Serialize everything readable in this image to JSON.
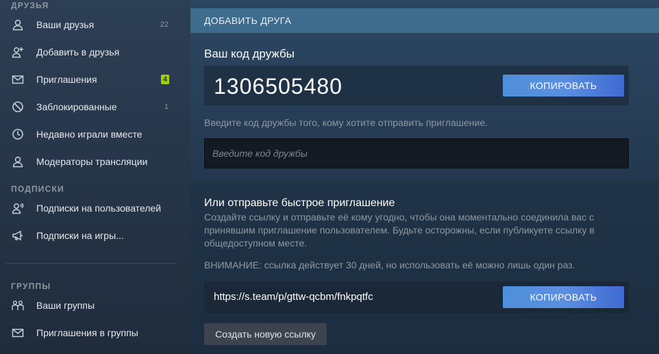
{
  "sidebar": {
    "friends_title": "ДРУЗЬЯ",
    "subscriptions_title": "ПОДПИСКИ",
    "groups_title": "ГРУППЫ",
    "items": [
      {
        "label": "Ваши друзья",
        "count": "22",
        "icon": "user-icon"
      },
      {
        "label": "Добавить в друзья",
        "icon": "add-user-icon"
      },
      {
        "label": "Приглашения",
        "badge": "4",
        "icon": "envelope-icon"
      },
      {
        "label": "Заблокированные",
        "count": "1",
        "icon": "block-icon"
      },
      {
        "label": "Недавно играли вместе",
        "icon": "clock-icon"
      },
      {
        "label": "Модераторы трансляции",
        "icon": "user-icon"
      },
      {
        "label": "Подписки на пользователей",
        "icon": "user-broadcast-icon"
      },
      {
        "label": "Подписки на игры...",
        "icon": "megaphone-icon"
      },
      {
        "label": "Ваши группы",
        "icon": "group-icon"
      },
      {
        "label": "Приглашения в группы",
        "icon": "envelope-icon"
      }
    ]
  },
  "main": {
    "header": "ДОБАВИТЬ ДРУГА",
    "friend_code_title": "Ваш код дружбы",
    "friend_code": "1306505480",
    "copy_label": "КОПИРОВАТЬ",
    "enter_hint": "Введите код дружбы того, кому хотите отправить приглашение.",
    "input_placeholder": "Введите код дружбы",
    "quick_invite_title": "Или отправьте быстрое приглашение",
    "quick_invite_desc": "Создайте ссылку и отправьте её кому угодно, чтобы она моментально соединила вас с принявшим приглашение пользователем. Будьте осторожны, если публикуете ссылку в общедоступном месте.",
    "warning": "ВНИМАНИЕ: ссылка действует 30 дней, но использовать её можно лишь один раз.",
    "invite_link": "https://s.team/p/gttw-qcbm/fnkpqtfc",
    "copy_link_label": "КОПИРОВАТЬ",
    "new_link_label": "Создать новую ссылку"
  },
  "colors": {
    "accent_blue": "#5a8fe0",
    "badge_green": "#a4d007",
    "header_blue": "#3d6c8d"
  }
}
